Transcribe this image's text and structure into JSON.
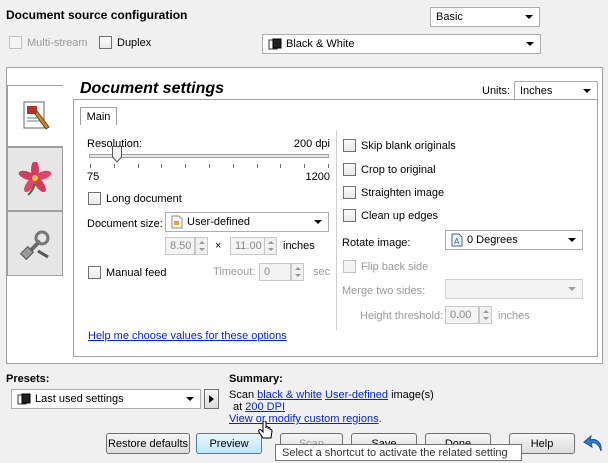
{
  "header": {
    "title": "Document source configuration",
    "mode_combo": "Basic",
    "multistream_label": "Multi-stream",
    "duplex_label": "Duplex",
    "color_combo": "Black & White"
  },
  "settings": {
    "title": "Document settings",
    "units_label": "Units:",
    "units_value": "Inches",
    "tab_main": "Main",
    "resolution_label": "Resolution:",
    "resolution_value": "200 dpi",
    "resolution_min": "75",
    "resolution_max": "1200",
    "resolution_level_fraction": 0.115,
    "long_document_label": "Long document",
    "document_size_label": "Document size:",
    "document_size_value": "User-defined",
    "width_value": "8.50",
    "times_sign": "×",
    "height_value": "11.00",
    "size_unit": "inches",
    "manual_feed_label": "Manual feed",
    "timeout_label": "Timeout:",
    "timeout_value": "0",
    "timeout_unit": "sec",
    "skip_blank_label": "Skip blank originals",
    "crop_label": "Crop to original",
    "straighten_label": "Straighten image",
    "clean_edges_label": "Clean up edges",
    "rotate_label": "Rotate image:",
    "rotate_value": "0 Degrees",
    "flip_back_label": "Flip back side",
    "merge_label": "Merge two sides:",
    "height_threshold_label": "Height threshold:",
    "height_threshold_value": "0.00",
    "height_threshold_unit": "inches",
    "help_link": "Help me choose values for these options"
  },
  "presets": {
    "label": "Presets:",
    "value": "Last used settings"
  },
  "summary": {
    "label": "Summary:",
    "scan_prefix": "Scan",
    "color_link": "black & white",
    "size_link": "User-defined",
    "suffix": "image(s)",
    "at_prefix": "at",
    "dpi_link": "200 DPI",
    "regions_link": "View or modify custom regions",
    "period": "."
  },
  "buttons": {
    "restore_defaults": "Restore defaults",
    "preview": "Preview",
    "scan": "Scan",
    "save": "Save",
    "done": "Done",
    "help": "Help"
  },
  "tooltip": "Select a shortcut to activate the related setting"
}
